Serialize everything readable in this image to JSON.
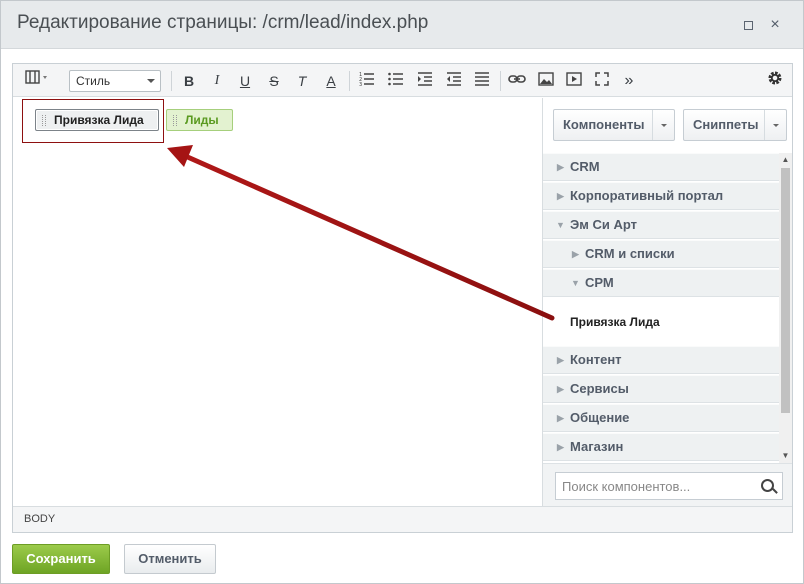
{
  "window": {
    "title": "Редактирование страницы: /crm/lead/index.php",
    "maximize_icon": "maximize-icon",
    "close_glyph": "×"
  },
  "toolbar": {
    "style_select_value": "Стиль",
    "bold": "B",
    "italic": "I",
    "underline": "U",
    "strike": "S",
    "remove_format": "T",
    "font_color": "A",
    "more": "»"
  },
  "canvas": {
    "components": [
      {
        "label": "Привязка Лида"
      },
      {
        "label": "Лиды"
      }
    ],
    "highlight_color": "#8e1010"
  },
  "sidebar": {
    "components_button": "Компоненты",
    "snippets_button": "Сниппеты",
    "tree": [
      {
        "label": "CRM",
        "expanded": false,
        "level": 0
      },
      {
        "label": "Корпоративный портал",
        "expanded": false,
        "level": 0
      },
      {
        "label": "Эм Си Арт",
        "expanded": true,
        "level": 0
      },
      {
        "label": "CRM и списки",
        "expanded": false,
        "level": 1
      },
      {
        "label": "СРМ",
        "expanded": true,
        "level": 1
      },
      {
        "label": "Привязка Лида",
        "leaf": true
      },
      {
        "label": "Контент",
        "expanded": false,
        "level": 0
      },
      {
        "label": "Сервисы",
        "expanded": false,
        "level": 0
      },
      {
        "label": "Общение",
        "expanded": false,
        "level": 0
      },
      {
        "label": "Магазин",
        "expanded": false,
        "level": 0
      }
    ],
    "search_placeholder": "Поиск компонентов..."
  },
  "statusbar": {
    "path": "BODY"
  },
  "footer": {
    "save_label": "Сохранить",
    "cancel_label": "Отменить"
  },
  "colors": {
    "save_green": "#7ab435",
    "arrow_red": "#a51414"
  }
}
